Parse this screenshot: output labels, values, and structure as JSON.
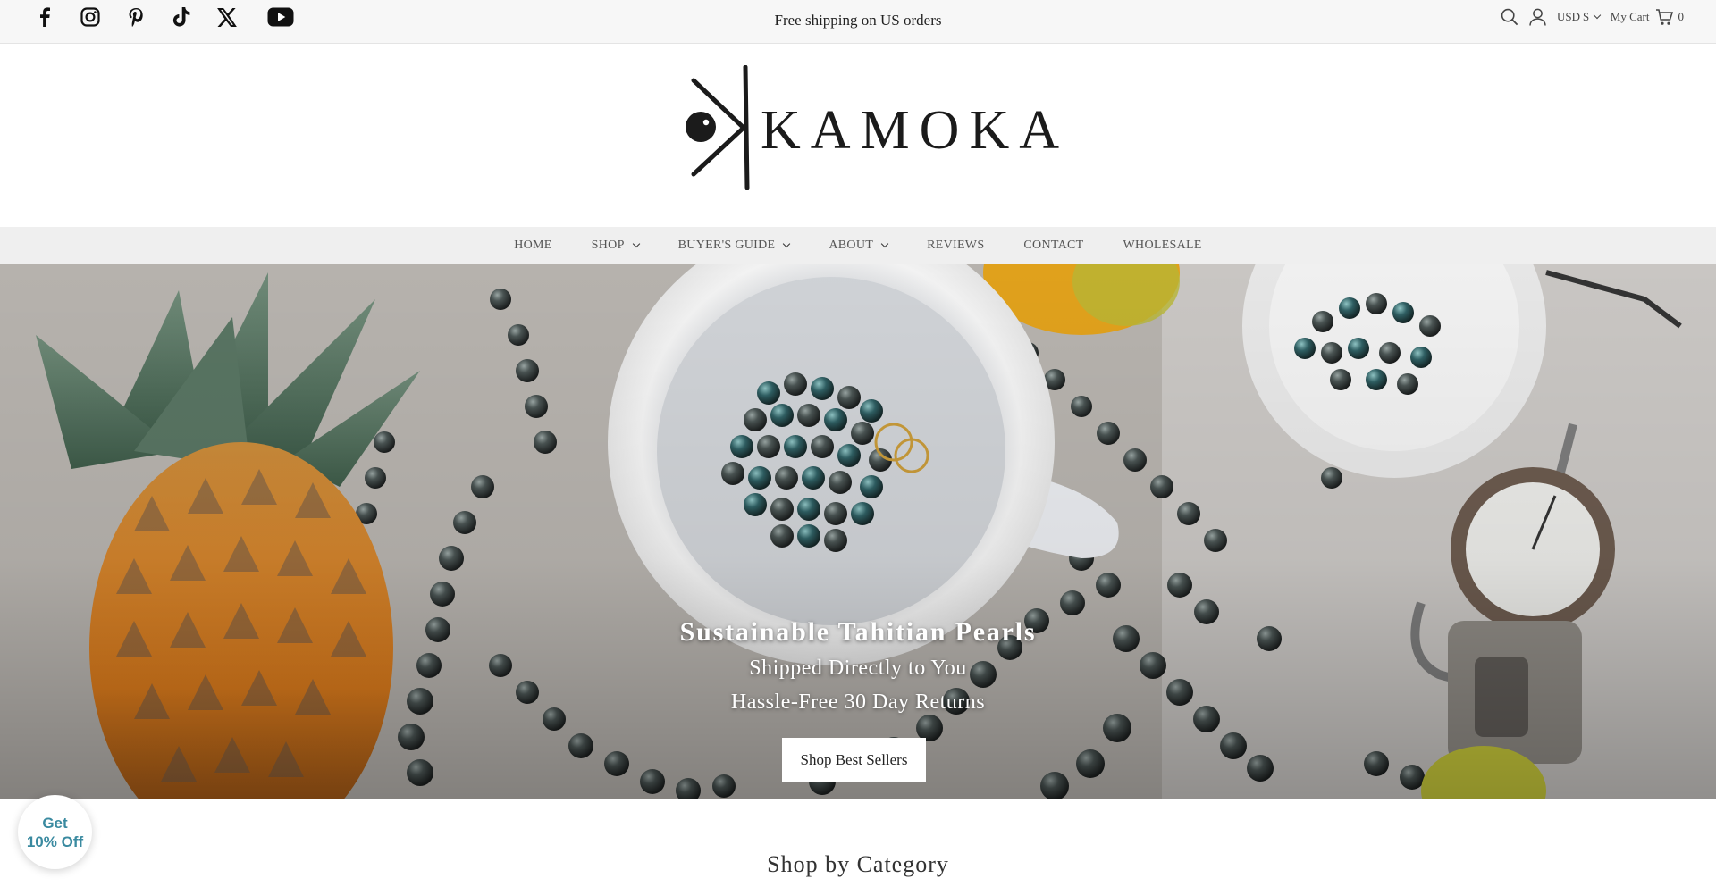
{
  "topbar": {
    "announcement": "Free shipping on US orders",
    "social_icons": [
      "facebook-icon",
      "instagram-icon",
      "pinterest-icon",
      "tiktok-icon",
      "x-icon",
      "youtube-icon"
    ],
    "currency": "USD $",
    "cart_label": "My Cart",
    "cart_count": "0"
  },
  "brand": {
    "name": "KAMOKA"
  },
  "nav": {
    "items": [
      {
        "label": "HOME",
        "has_dropdown": false
      },
      {
        "label": "SHOP",
        "has_dropdown": true
      },
      {
        "label": "BUYER'S GUIDE",
        "has_dropdown": true
      },
      {
        "label": "ABOUT",
        "has_dropdown": true
      },
      {
        "label": "REVIEWS",
        "has_dropdown": false
      },
      {
        "label": "CONTACT",
        "has_dropdown": false
      },
      {
        "label": "WHOLESALE",
        "has_dropdown": false
      }
    ]
  },
  "hero": {
    "title": "Sustainable Tahitian Pearls",
    "line1": "Shipped Directly to You",
    "line2": "Hassle-Free 30 Day Returns",
    "button_label": "Shop Best Sellers"
  },
  "promo": {
    "line1": "Get",
    "line2": "10% Off"
  },
  "section": {
    "title": "Shop by Category"
  },
  "colors": {
    "promo_text": "#3a8aa0",
    "nav_bg": "#efefef",
    "topbar_bg": "#f7f7f7"
  }
}
